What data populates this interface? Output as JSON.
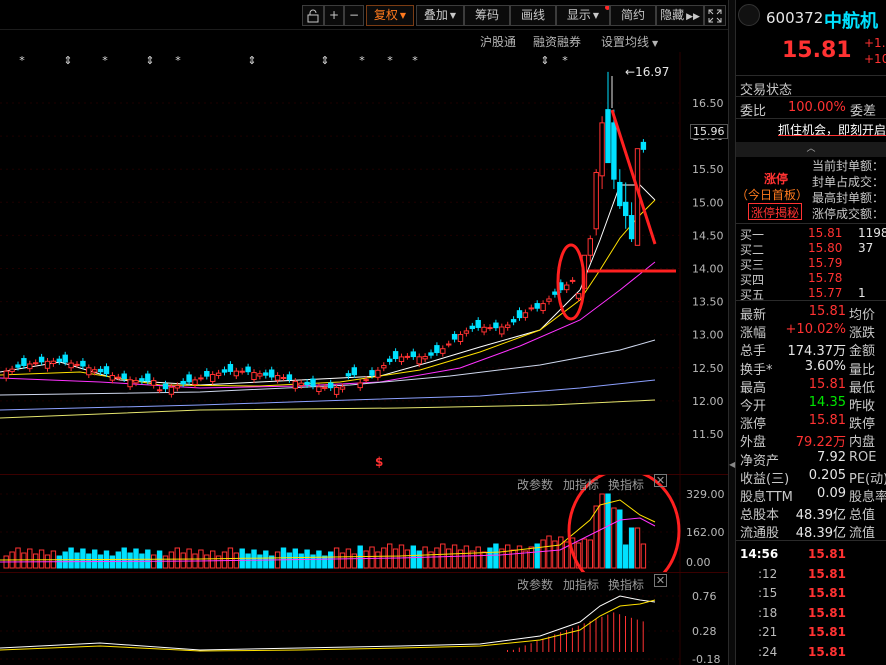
{
  "toolbar": {
    "buttons": [
      {
        "label": "",
        "icon": "lock-icon"
      },
      {
        "label": "+"
      },
      {
        "label": "−"
      },
      {
        "label": "复权",
        "dropdown": true,
        "active": true
      },
      {
        "label": "叠加",
        "dropdown": true
      },
      {
        "label": "筹码"
      },
      {
        "label": "画线"
      },
      {
        "label": "显示",
        "dropdown": true,
        "dot": true
      },
      {
        "label": "简约"
      },
      {
        "label": "隐藏",
        "icon": "double-right-icon"
      },
      {
        "label": "",
        "icon": "expand-icon"
      }
    ]
  },
  "subbar": {
    "links": [
      "沪股通",
      "融资融券",
      "设置均线"
    ]
  },
  "main_chart": {
    "max_label": "16.97",
    "current_price_label": "15.96",
    "y_ticks": [
      "16.50",
      "16.00",
      "15.50",
      "15.00",
      "14.50",
      "14.00",
      "13.50",
      "13.00",
      "12.50",
      "12.00",
      "11.50"
    ],
    "event_markers": [
      "*",
      "⇕",
      "*",
      "⇕",
      "*",
      "⇕",
      "⇕",
      "*",
      "*",
      "*",
      "⇕",
      "*"
    ],
    "dividend_marker": "$"
  },
  "volume_panel": {
    "links": [
      "改参数",
      "加指标",
      "换指标"
    ],
    "y_ticks": [
      "329.00",
      "162.00",
      "0.00"
    ]
  },
  "indicator_panel": {
    "links": [
      "改参数",
      "加指标",
      "换指标"
    ],
    "y_ticks": [
      "0.76",
      "0.28",
      "-0.18"
    ]
  },
  "chart_data": {
    "type": "candlestick",
    "y_range": [
      11.2,
      17.2
    ],
    "max_annotation": 16.97,
    "reference_line": 15.96,
    "volume_ticks": [
      329.0,
      162.0,
      0.0
    ],
    "indicator_ticks": [
      0.76,
      0.28,
      -0.18
    ]
  },
  "colors": {
    "up": "#ff3232",
    "down": "#00e1ff",
    "ma5": "#ffffff",
    "ma10": "#ffe100",
    "ma20": "#ff32ff",
    "ma60": "#cfd8ee",
    "ma120": "#e6e66e",
    "annotation": "#ff2020"
  },
  "quote": {
    "code": "600372",
    "name": "中航机",
    "price": "15.81",
    "change": "+1.",
    "change_pct": "+10",
    "trade_status_label": "交易状态",
    "weibi_label": "委比",
    "weibi_value": "100.00%",
    "weicha_label": "委差",
    "ad_text": "抓住机会，即刻开启",
    "limit_title": "涨停",
    "limit_sub": "（今日首板）",
    "limit_button": "涨停揭秘",
    "seal_labels": [
      "当前封单额：",
      "封单占成交：",
      "最高封单额：",
      "涨停成交额："
    ],
    "seal_values": [
      "",
      "",
      "",
      ""
    ],
    "bids": [
      {
        "label": "买一",
        "price": "15.81",
        "vol": "1198"
      },
      {
        "label": "买二",
        "price": "15.80",
        "vol": "37"
      },
      {
        "label": "买三",
        "price": "15.79",
        "vol": ""
      },
      {
        "label": "买四",
        "price": "15.78",
        "vol": ""
      },
      {
        "label": "买五",
        "price": "15.77",
        "vol": "1"
      }
    ],
    "stats": [
      {
        "label": "最新",
        "value": "15.81",
        "color": "red",
        "label2": "均价"
      },
      {
        "label": "涨幅",
        "value": "+10.02%",
        "color": "red",
        "label2": "涨跌"
      },
      {
        "label": "总手",
        "value": "174.37万",
        "color": "white",
        "label2": "金额"
      },
      {
        "label": "换手*",
        "value": "3.60%",
        "color": "white",
        "label2": "量比"
      },
      {
        "label": "最高",
        "value": "15.81",
        "color": "red",
        "label2": "最低"
      },
      {
        "label": "今开",
        "value": "14.35",
        "color": "green",
        "label2": "昨收"
      },
      {
        "label": "涨停",
        "value": "15.81",
        "color": "red",
        "label2": "跌停"
      },
      {
        "label": "外盘",
        "value": "79.22万",
        "color": "red",
        "label2": "内盘"
      },
      {
        "label": "净资产",
        "value": "7.92",
        "color": "white",
        "label2": "ROE"
      },
      {
        "label": "收益(三)",
        "value": "0.205",
        "color": "white",
        "label2": "PE(动)"
      },
      {
        "label": "股息TTM",
        "value": "0.09",
        "color": "white",
        "label2": "股息率"
      },
      {
        "label": "总股本",
        "value": "48.39亿",
        "color": "white",
        "label2": "总值"
      },
      {
        "label": "流通股",
        "value": "48.39亿",
        "color": "white",
        "label2": "流值"
      }
    ],
    "ticks": [
      {
        "time": "14:56",
        "price": "15.81"
      },
      {
        "time": ":12",
        "price": "15.81"
      },
      {
        "time": ":15",
        "price": "15.81"
      },
      {
        "time": ":18",
        "price": "15.81"
      },
      {
        "time": ":21",
        "price": "15.81"
      },
      {
        "time": ":24",
        "price": "15.81"
      }
    ]
  }
}
